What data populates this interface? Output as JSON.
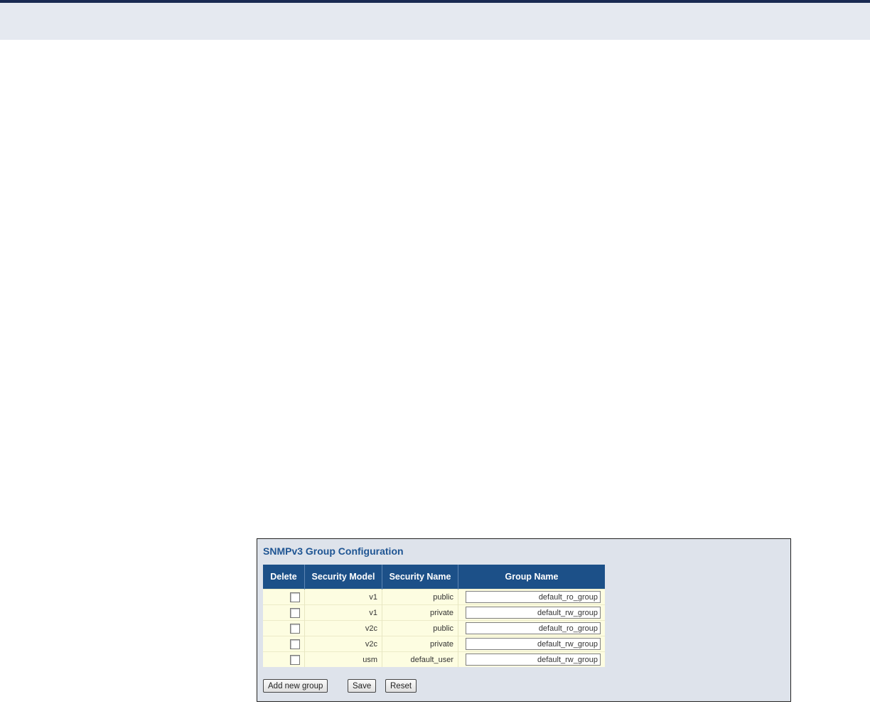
{
  "panel": {
    "title": "SNMPv3 Group Configuration",
    "columns": [
      "Delete",
      "Security Model",
      "Security Name",
      "Group Name"
    ],
    "rows": [
      {
        "security_model": "v1",
        "security_name": "public",
        "group_name": "default_ro_group"
      },
      {
        "security_model": "v1",
        "security_name": "private",
        "group_name": "default_rw_group"
      },
      {
        "security_model": "v2c",
        "security_name": "public",
        "group_name": "default_ro_group"
      },
      {
        "security_model": "v2c",
        "security_name": "private",
        "group_name": "default_rw_group"
      },
      {
        "security_model": "usm",
        "security_name": "default_user",
        "group_name": "default_rw_group"
      }
    ]
  },
  "buttons": {
    "add_label": "Add new group",
    "save_label": "Save",
    "reset_label": "Reset"
  },
  "colors": {
    "header_bg": "#1c5088",
    "panel_bg": "#dee3eb",
    "title": "#1f5593",
    "row_bg": "#fdfde1"
  }
}
